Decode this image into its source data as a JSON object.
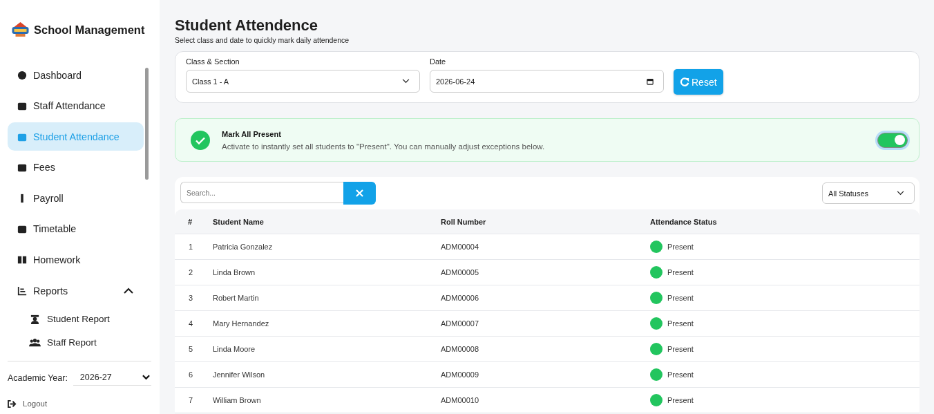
{
  "sidebar": {
    "brand": "School Management",
    "items": [
      {
        "label": "Dashboard",
        "selected": false
      },
      {
        "label": "Staff Attendance",
        "selected": false
      },
      {
        "label": "Student Attendance",
        "selected": true
      },
      {
        "label": "Fees",
        "selected": false
      },
      {
        "label": "Payroll",
        "selected": false
      },
      {
        "label": "Timetable",
        "selected": false
      },
      {
        "label": "Homework",
        "selected": false
      },
      {
        "label": "Reports",
        "selected": false,
        "expanded": true,
        "children": [
          {
            "label": "Student Report",
            "selected": false
          },
          {
            "label": "Staff Report",
            "selected": false
          }
        ]
      }
    ],
    "academic_year": {
      "label": "Academic Year:",
      "value": "2026-27"
    },
    "logout": "Logout"
  },
  "page": {
    "title": "Student Attendence",
    "subtitle": "Select class and date to quickly mark daily attendence"
  },
  "filters": {
    "class_label": "Class & Section",
    "class_value": "Class 1 - A",
    "date_label": "Date",
    "date_value": "2026-06-24",
    "reset": "Reset"
  },
  "mark_all": {
    "title": "Mark All Present",
    "description": "Activate to instantly set all students to \"Present\". You can manually adjust exceptions below.",
    "on": true
  },
  "table": {
    "search_placeholder": "Search...",
    "status_filter": "All Statuses",
    "columns": [
      "#",
      "Student Name",
      "Roll Number",
      "Attendance Status"
    ],
    "rows": [
      {
        "no": "1",
        "name": "Patricia Gonzalez",
        "roll": "ADM00004",
        "status": "Present",
        "color": "#22c55e"
      },
      {
        "no": "2",
        "name": "Linda Brown",
        "roll": "ADM00005",
        "status": "Present",
        "color": "#22c55e"
      },
      {
        "no": "3",
        "name": "Robert Martin",
        "roll": "ADM00006",
        "status": "Present",
        "color": "#22c55e"
      },
      {
        "no": "4",
        "name": "Mary Hernandez",
        "roll": "ADM00007",
        "status": "Present",
        "color": "#22c55e"
      },
      {
        "no": "5",
        "name": "Linda Moore",
        "roll": "ADM00008",
        "status": "Present",
        "color": "#22c55e"
      },
      {
        "no": "6",
        "name": "Jennifer Wilson",
        "roll": "ADM00009",
        "status": "Present",
        "color": "#22c55e"
      },
      {
        "no": "7",
        "name": "William Brown",
        "roll": "ADM00010",
        "status": "Present",
        "color": "#22c55e"
      }
    ]
  }
}
